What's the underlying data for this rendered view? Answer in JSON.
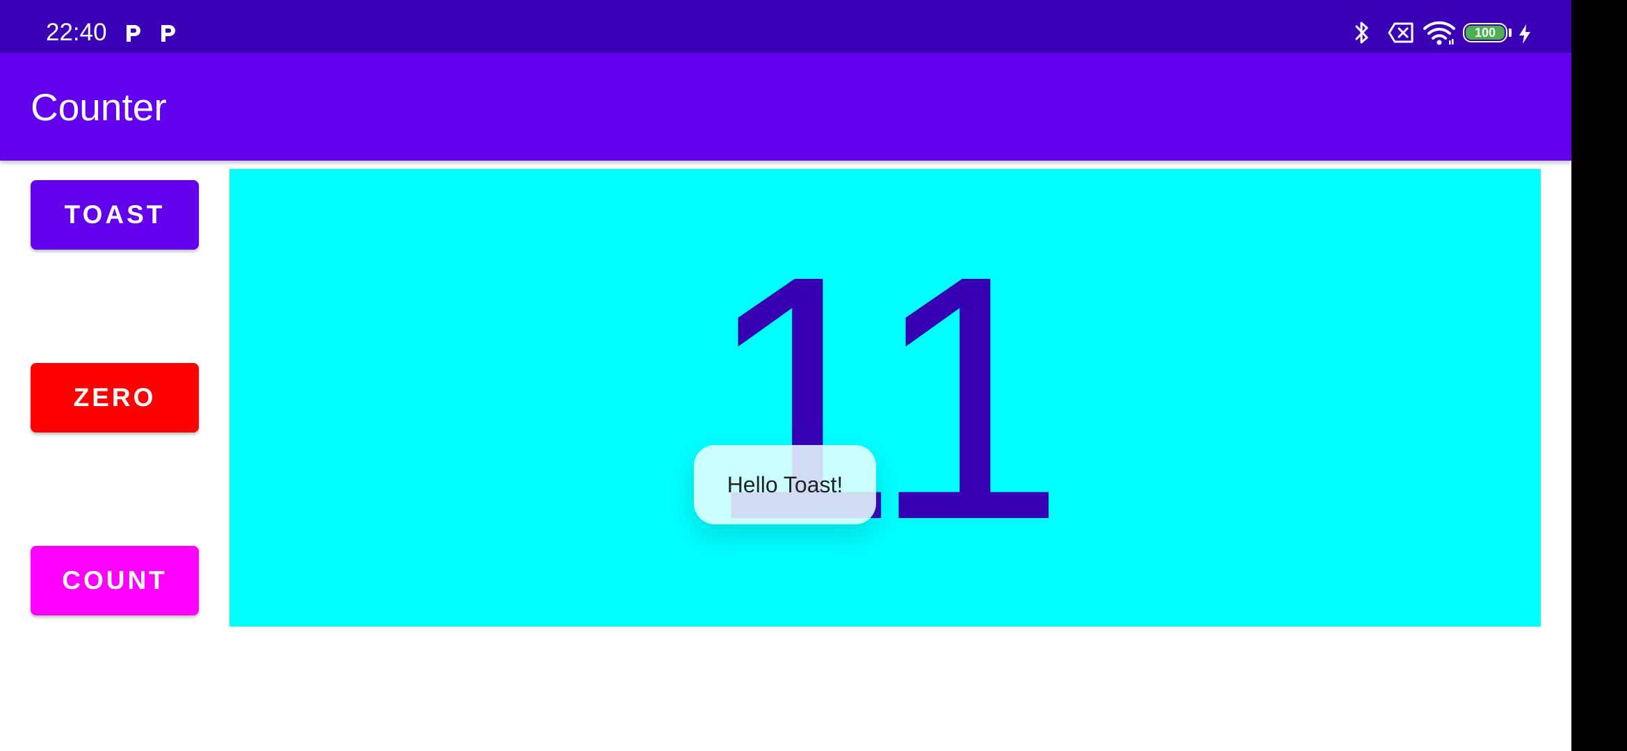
{
  "status_bar": {
    "time": "22:40",
    "notification_icons": [
      "parking-app-icon",
      "parking-app-icon"
    ],
    "system_icons": [
      "bluetooth-icon",
      "sim-missing-icon",
      "wifi-icon",
      "battery-icon",
      "charging-icon"
    ],
    "battery_level": "100"
  },
  "app_bar": {
    "title": "Counter"
  },
  "buttons": {
    "toast_label": "TOAST",
    "zero_label": "ZERO",
    "count_label": "COUNT"
  },
  "counter": {
    "value": "11"
  },
  "toast": {
    "message": "Hello Toast!"
  },
  "colors": {
    "status_bar": "#3A00B5",
    "app_bar": "#6200EE",
    "toast_button": "#6200EE",
    "zero_button": "#FF0000",
    "count_button": "#FF00FF",
    "count_panel": "#00FFFF",
    "count_text": "#3700B3",
    "battery_fill": "#4CAF50"
  }
}
